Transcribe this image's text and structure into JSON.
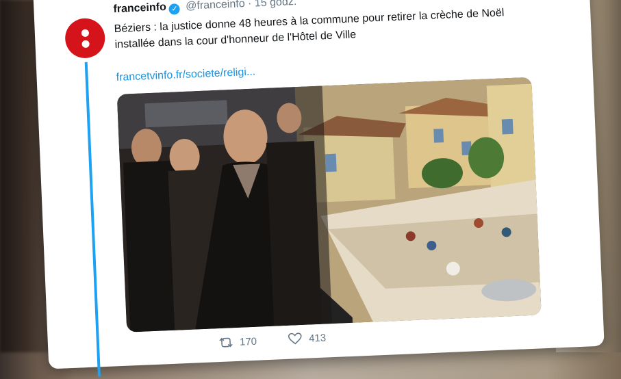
{
  "tweet": {
    "name": "franceinfo",
    "handle": "@franceinfo",
    "separator": "·",
    "time": "15 godz.",
    "text_line1": "Béziers : la justice donne 48 heures à la commune pour retirer la crèche de Noël",
    "text_line2": "installée dans la cour d'honneur de l'Hôtel de Ville",
    "link": "francetvinfo.fr/societe/religi...",
    "verified_mark": "✓",
    "retweets": "170",
    "likes": "413"
  },
  "icons": {
    "verified": "verified-badge-icon",
    "retweet": "retweet-icon",
    "like": "heart-icon"
  },
  "colors": {
    "brand_red": "#d4141a",
    "twitter_blue": "#1da1f2",
    "link_blue": "#1b95e0",
    "text_dark": "#14171a",
    "text_gray": "#657786"
  }
}
